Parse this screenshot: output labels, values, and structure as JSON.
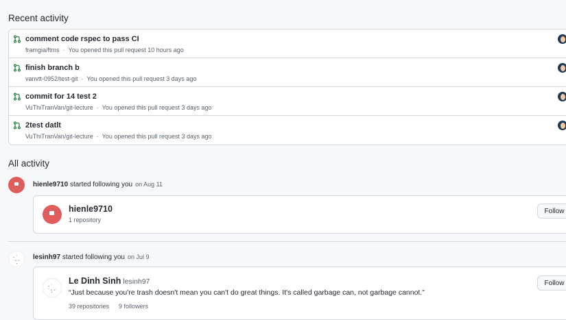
{
  "recent": {
    "title": "Recent activity",
    "items": [
      {
        "title": "comment code rspec to pass CI",
        "repo": "framgia/ftms",
        "status": "You opened this pull request 10 hours ago"
      },
      {
        "title": "finish branch b",
        "repo": "vanvtt-0952/test-git",
        "status": "You opened this pull request 3 days ago"
      },
      {
        "title": "commit for 14 test 2",
        "repo": "VuThiTranVan/git-lecture",
        "status": "You opened this pull request 3 days ago"
      },
      {
        "title": "2test datlt",
        "repo": "VuThiTranVan/git-lecture",
        "status": "You opened this pull request 3 days ago"
      }
    ],
    "separator": "·"
  },
  "all": {
    "title": "All activity",
    "events": [
      {
        "user": "hienle9710",
        "verb": "started following you",
        "when": "on Aug 11",
        "card": {
          "name": "hienle9710",
          "repos": "1 repository",
          "follow_label": "Follow"
        }
      },
      {
        "user": "lesinh97",
        "verb": "started following you",
        "when": "on Jul 9",
        "card": {
          "name": "Le Dinh Sinh",
          "login": "lesinh97",
          "bio": "“Just because you're trash doesn't mean you can't do great things. It's called garbage can, not garbage cannot.”",
          "repos": "39 repositories",
          "followers": "9 followers",
          "follow_label": "Follow"
        }
      }
    ]
  },
  "colors": {
    "pr_icon": "#1a7f37",
    "avatar_red": "#e05d5d"
  }
}
